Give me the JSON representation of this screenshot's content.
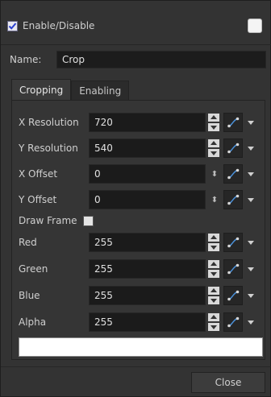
{
  "header": {
    "enable_label": "Enable/Disable",
    "enabled": true,
    "swatch_color": "#f4f4f4"
  },
  "name": {
    "label": "Name:",
    "value": "Crop"
  },
  "tabs": [
    {
      "label": "Cropping",
      "active": true
    },
    {
      "label": "Enabling",
      "active": false
    }
  ],
  "params": [
    {
      "label": "X Resolution",
      "value": "720"
    },
    {
      "label": "Y Resolution",
      "value": "540"
    },
    {
      "label": "X Offset",
      "value": "0"
    },
    {
      "label": "Y Offset",
      "value": "0"
    },
    {
      "label": "Red",
      "value": "255"
    },
    {
      "label": "Green",
      "value": "255"
    },
    {
      "label": "Blue",
      "value": "255"
    },
    {
      "label": "Alpha",
      "value": "255"
    }
  ],
  "draw_frame": {
    "label": "Draw Frame",
    "checked": false
  },
  "footer": {
    "close_label": "Close"
  },
  "colors": {
    "accent": "#4a90d9",
    "background": "#333333"
  }
}
